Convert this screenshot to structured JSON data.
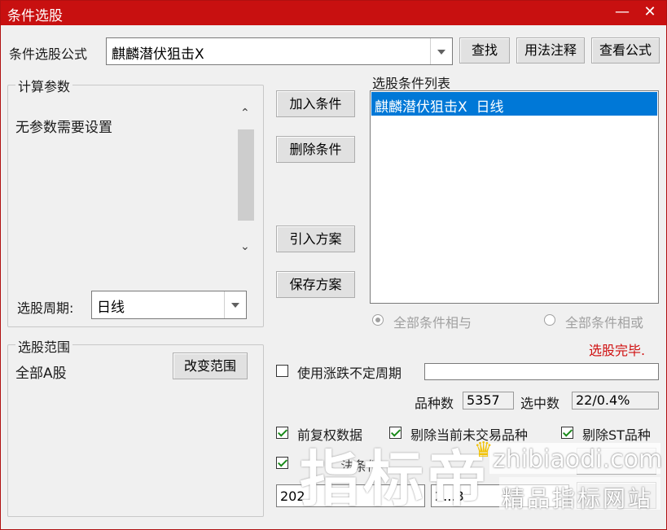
{
  "window": {
    "title": "条件选股"
  },
  "formula": {
    "label": "条件选股公式",
    "value": "麒麟潜伏狙击X"
  },
  "buttons": {
    "find": "查找",
    "usage": "用法注释",
    "view": "查看公式",
    "add": "加入条件",
    "delete": "删除条件",
    "import": "引入方案",
    "save": "保存方案",
    "change_range": "改变范围"
  },
  "params": {
    "title": "计算参数",
    "text": "无参数需要设置",
    "period_label": "选股周期:",
    "period_value": "日线"
  },
  "conditions": {
    "title": "选股条件列表",
    "items": [
      "麒麟潜伏狙击X  日线"
    ]
  },
  "logic": {
    "and_label": "全部条件相与",
    "or_label": "全部条件相或",
    "selected": "and"
  },
  "status": {
    "text": "选股完毕.",
    "color": "#d01010"
  },
  "range": {
    "title": "选股范围",
    "value": "全部A股"
  },
  "options": {
    "volatile_period": "使用涨跌不定周期",
    "total_label": "品种数",
    "total_value": "5357",
    "hit_label": "选中数",
    "hit_value": "22/0.4%",
    "pre_adjust": "前复权数据",
    "remove_untraded": "剔除当前未交易品种",
    "remove_st": "剔除ST品种",
    "partial_label": "...法条件",
    "date_from": "202",
    "date_to": "2...3"
  },
  "watermark": {
    "main": "指标帝",
    "site": "zhibiaodi.com",
    "slogan": "精品指标网站"
  }
}
